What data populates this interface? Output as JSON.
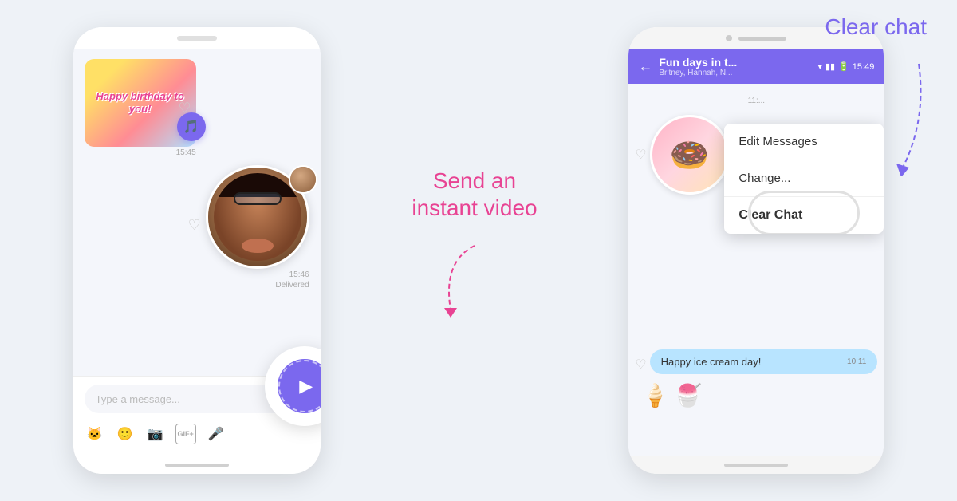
{
  "background_color": "#eef2f7",
  "label_send": {
    "line1": "Send an",
    "line2": "instant video",
    "color": "#e84393"
  },
  "label_clear": {
    "text": "Clear chat",
    "color": "#7b68ee"
  },
  "left_phone": {
    "sticker_text": "Happy birthday\nto you!",
    "timestamp1": "15:45",
    "timestamp2": "15:46",
    "delivered": "Delivered",
    "input_placeholder": "Type a message...",
    "toolbar_icons": [
      "emoji",
      "sticker",
      "camera",
      "gif",
      "mic"
    ]
  },
  "right_phone": {
    "status_bar": {
      "time": "15:49",
      "wifi": "▾",
      "signal": "▮▮▮",
      "battery": "▮▮▮"
    },
    "chat_title": "Fun days in t...",
    "chat_subtitle": "Britney, Hannah, N...",
    "dropdown": {
      "items": [
        "Edit Messages",
        "Change...",
        "Clear Chat"
      ]
    },
    "message": "Happy ice cream day!",
    "message_time": "10:11"
  }
}
